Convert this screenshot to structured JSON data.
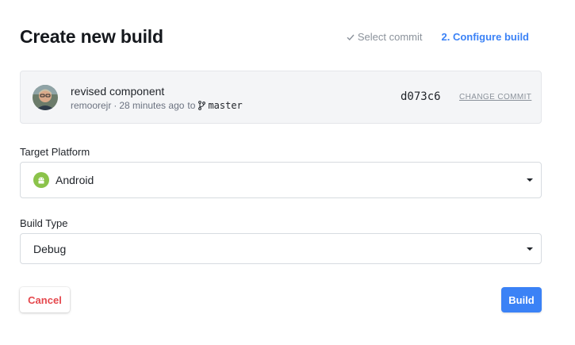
{
  "page": {
    "title": "Create new build"
  },
  "steps": {
    "step1": "Select commit",
    "step2": "2. Configure build",
    "active_color": "#3b82f6"
  },
  "commit": {
    "message": "revised component",
    "author": "remoorejr",
    "separator": "·",
    "time": "28 minutes ago",
    "to": "to",
    "branch": "master",
    "hash": "d073c6",
    "change_label": "CHANGE COMMIT"
  },
  "target_platform": {
    "label": "Target Platform",
    "value": "Android",
    "icon": "android-icon"
  },
  "build_type": {
    "label": "Build Type",
    "value": "Debug"
  },
  "actions": {
    "cancel_label": "Cancel",
    "build_label": "Build",
    "cancel_color": "#e5484d",
    "build_color": "#3b82f6"
  }
}
